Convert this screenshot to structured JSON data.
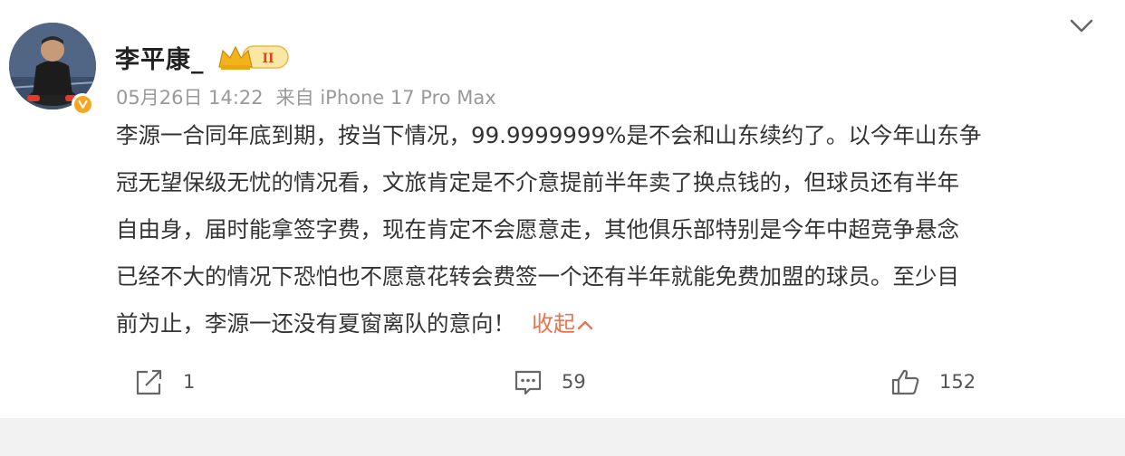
{
  "post": {
    "username": "李平康_",
    "vip_level": "II",
    "date": "05月26日 14:22",
    "source": "来自 iPhone 17 Pro Max",
    "content_lines": [
      "李源一合同年底到期，按当下情况，99.9999999%是不会和山东续约了。以今年山东争",
      "冠无望保级无忧的情况看，文旅肯定是不介意提前半年卖了换点钱的，但球员还有半年",
      "自由身，届时能拿签字费，现在肯定不会愿意走，其他俱乐部特别是今年中超竞争悬念",
      "已经不大的情况下恐怕也不愿意花转会费签一个还有半年就能免费加盟的球员。至少目",
      "前为止，李源一还没有夏窗离队的意向！"
    ],
    "collapse_label": "收起",
    "actions": {
      "repost_count": "1",
      "comment_count": "59",
      "like_count": "152"
    }
  },
  "colors": {
    "accent_orange": "#eb7350",
    "verify_gold": "#f5a623",
    "meta_gray": "#999999"
  },
  "icons": [
    "avatar-photo",
    "verified-v-icon",
    "vip-crown-icon",
    "chevron-down-icon",
    "repost-icon",
    "comment-icon",
    "like-thumb-icon",
    "chevron-up-icon"
  ]
}
